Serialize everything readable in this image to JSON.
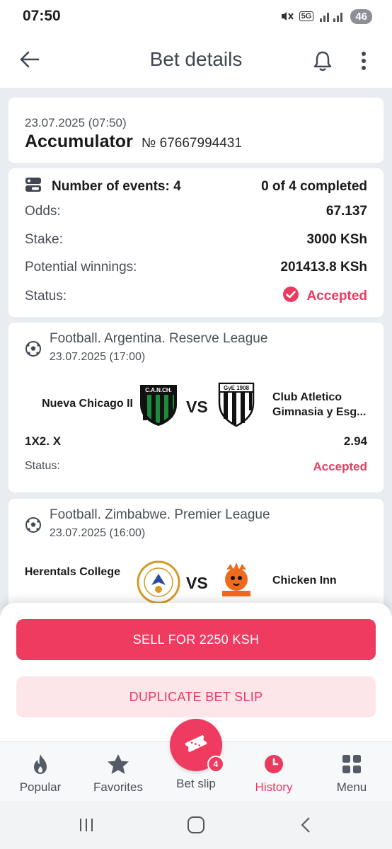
{
  "status_bar": {
    "time": "07:50",
    "network": "5G",
    "battery": "46"
  },
  "app_bar": {
    "title": "Bet details",
    "back_icon": "arrow-left-icon",
    "bell_icon": "bell-icon",
    "more_icon": "more-vertical-icon"
  },
  "header": {
    "date": "23.07.2025 (07:50)",
    "bet_type": "Accumulator",
    "number": "№ 67667994431"
  },
  "summary": {
    "events_label": "Number of events: 4",
    "completed": "0 of 4 completed",
    "odds_label": "Odds:",
    "odds_value": "67.137",
    "stake_label": "Stake:",
    "stake_value": "3000 KSh",
    "winnings_label": "Potential winnings:",
    "winnings_value": "201413.8 KSh",
    "status_label": "Status:",
    "status_value": "Accepted"
  },
  "events": [
    {
      "league": "Football. Argentina. Reserve League",
      "date": "23.07.2025 (17:00)",
      "home": "Nueva Chicago II",
      "away": "Club Atletico Gimnasia y Esg...",
      "home_logo_text": "C.A.N.CH.",
      "away_logo_text": "GyE 1908",
      "vs": "VS",
      "market": "1X2. X",
      "odd": "2.94",
      "status_label": "Status:",
      "status_value": "Accepted"
    },
    {
      "league": "Football. Zimbabwe. Premier League",
      "date": "23.07.2025 (16:00)",
      "home": "Herentals College",
      "away": "Chicken Inn",
      "vs": "VS"
    }
  ],
  "actions": {
    "sell": "SELL FOR 2250 KSH",
    "duplicate": "DUPLICATE BET SLIP"
  },
  "nav": {
    "popular": "Popular",
    "favorites": "Favorites",
    "betslip": "Bet slip",
    "history": "History",
    "menu": "Menu",
    "betslip_count": "4"
  },
  "colors": {
    "accent": "#f03b60",
    "accent_light": "#fde6ea",
    "background": "#e9ecf1"
  }
}
